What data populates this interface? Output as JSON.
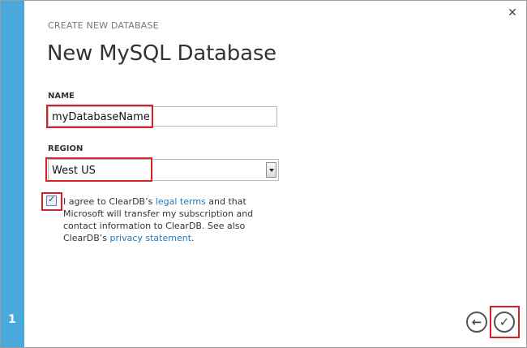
{
  "step": {
    "number": "1"
  },
  "header": {
    "subtitle": "CREATE NEW DATABASE",
    "title": "New MySQL Database"
  },
  "form": {
    "name_label": "NAME",
    "name_value": "myDatabaseName",
    "region_label": "REGION",
    "region_value": "West US",
    "agreement": {
      "checked": true,
      "text_1": "I agree to ClearDB’s ",
      "legal_link": "legal terms",
      "text_2": " and that Microsoft will transfer my subscription and contact information to ClearDB. See also ClearDB’s ",
      "privacy_link": "privacy statement",
      "text_3": "."
    }
  },
  "icons": {
    "close": "close-icon",
    "back": "back-arrow-icon",
    "complete": "checkmark-icon"
  },
  "colors": {
    "step_strip": "#4aa9dc",
    "highlight": "#d6202a",
    "link": "#1e7abd"
  }
}
